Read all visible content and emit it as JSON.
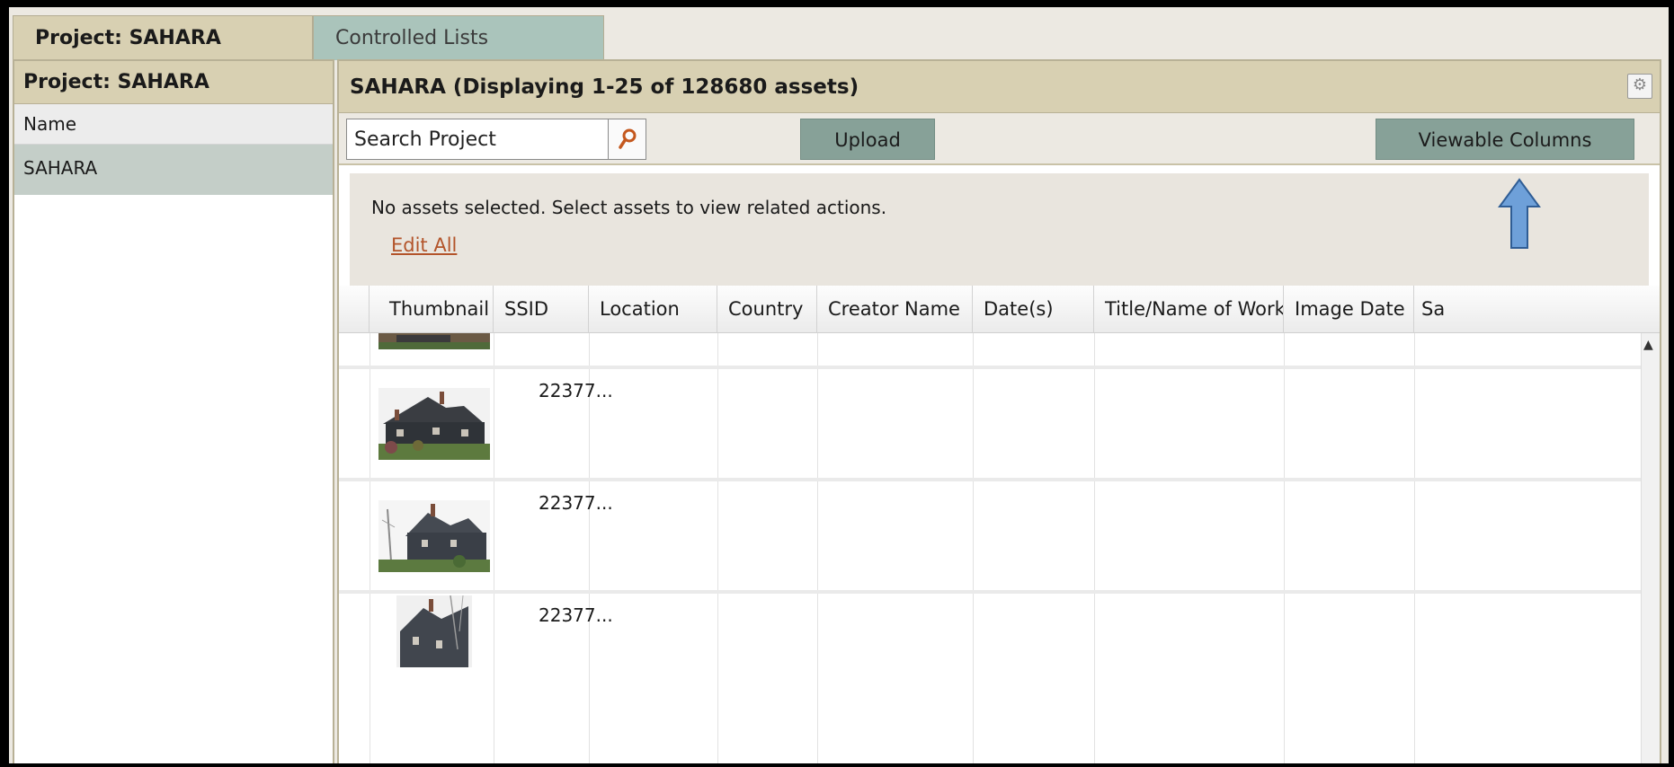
{
  "tabs": [
    {
      "label": "Project: SAHARA"
    },
    {
      "label": "Controlled Lists"
    }
  ],
  "left_panel": {
    "title": "Project: SAHARA",
    "column_header": "Name",
    "rows": [
      "SAHARA"
    ]
  },
  "right_panel": {
    "title": "SAHARA (Displaying 1-25 of 128680 assets)",
    "search_placeholder": "Search Project",
    "upload_label": "Upload",
    "viewable_columns_label": "Viewable Columns",
    "notice_text": "No assets selected.  Select assets to view related actions.",
    "edit_all_label": "Edit All"
  },
  "grid": {
    "columns": [
      "Thumbnail",
      "SSID",
      "Location",
      "Country",
      "Creator Name",
      "Date(s)",
      "Title/Name of Work",
      "Image Date",
      "Sa"
    ],
    "rows": [
      {
        "ssid": ""
      },
      {
        "ssid": "22377..."
      },
      {
        "ssid": "22377..."
      },
      {
        "ssid": "22377..."
      }
    ]
  },
  "colors": {
    "tab_active": "#d8d0b2",
    "tab_inactive": "#aac4bb",
    "button": "#87a198",
    "link": "#b3542a",
    "annotation_arrow": "#6ea0d9"
  }
}
